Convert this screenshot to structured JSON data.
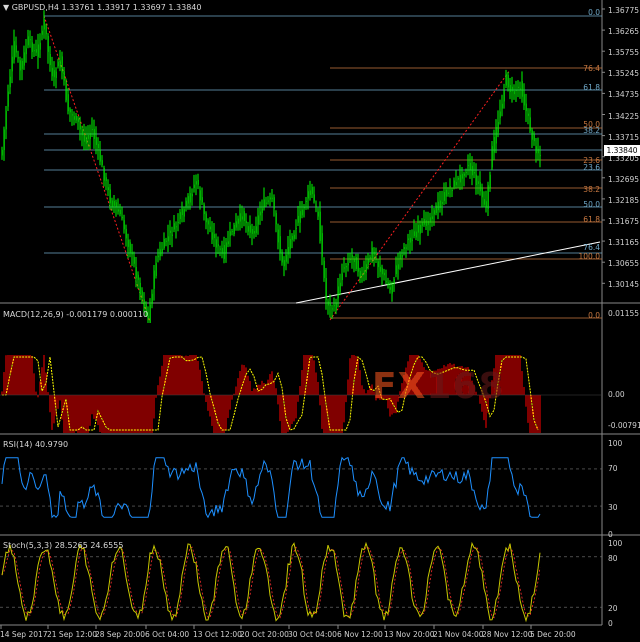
{
  "header": {
    "symbol": "GBPUSD,H4",
    "ohlc": "1.33761 1.33917 1.33697 1.33840"
  },
  "price_axis": [
    "1.36775",
    "1.36265",
    "1.35755",
    "1.35245",
    "1.34735",
    "1.34225",
    "1.33715",
    "1.33205",
    "1.32695",
    "1.32185",
    "1.31675",
    "1.31165",
    "1.30655",
    "1.30145"
  ],
  "current_price": "1.33840",
  "fib_left": [
    "100.0",
    "61.8",
    "50.0",
    "38.2",
    "23.6"
  ],
  "fib_right": [
    "0.0",
    "76.4",
    "61.8",
    "50.0",
    "38.2",
    "23.6",
    "23.6",
    "38.2",
    "50.0",
    "61.8",
    "76.4",
    "100.0",
    "0.0"
  ],
  "macd": {
    "title": "MACD(12,26,9) -0.001179 0.000110",
    "axis": [
      "0.01155",
      "0.00",
      "-0.007911"
    ]
  },
  "rsi": {
    "title": "RSI(14) 40.9790",
    "axis": [
      "100",
      "70",
      "30",
      "0"
    ]
  },
  "stoch": {
    "title": "Stoch(5,3,3) 28.5265 24.6555",
    "axis": [
      "100",
      "80",
      "20",
      "0"
    ]
  },
  "dates": [
    "14 Sep 2017",
    "21 Sep 12:00",
    "28 Sep 20:00",
    "6 Oct 04:00",
    "13 Oct 12:00",
    "20 Oct 20:00",
    "30 Oct 04:00",
    "6 Nov 12:00",
    "13 Nov 20:00",
    "21 Nov 04:00",
    "28 Nov 12:00",
    "5 Dec 20:00"
  ],
  "watermark": {
    "part1": "FX",
    "part2": "168"
  },
  "colors": {
    "candle": "#00ff00",
    "macd_hist": "#ff0000",
    "signal": "#ffff00",
    "rsi": "#1e90ff",
    "stoch_main": "#c8c800",
    "stoch_signal": "#ff3030",
    "fib_blue": "#6fa8c8",
    "fib_orange": "#c87840"
  }
}
